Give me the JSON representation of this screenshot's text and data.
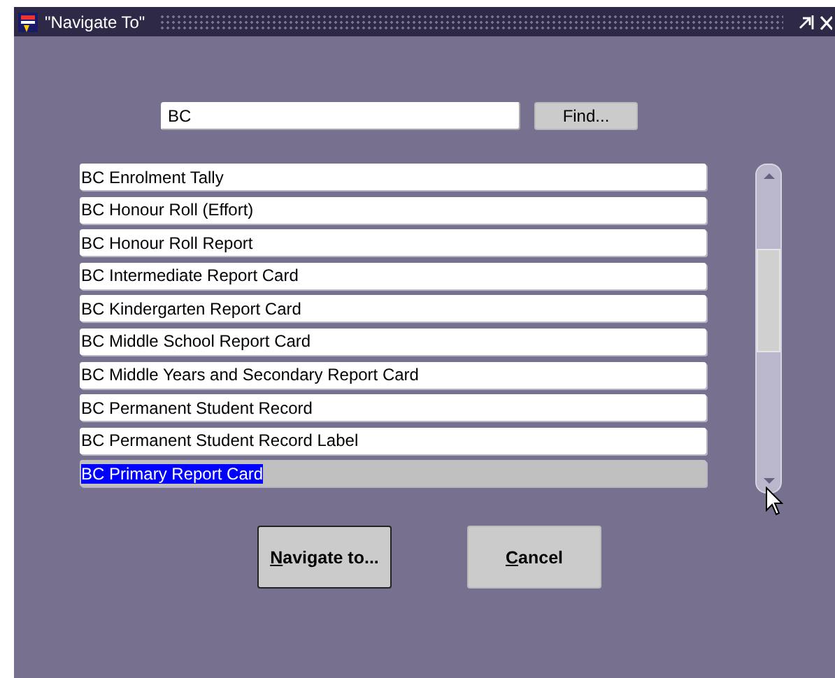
{
  "window": {
    "title": "\"Navigate To\""
  },
  "search": {
    "value": "BC"
  },
  "find_button": {
    "label": "Find..."
  },
  "items": [
    {
      "label": "BC Enrolment Tally",
      "selected": false
    },
    {
      "label": "BC Honour Roll (Effort)",
      "selected": false
    },
    {
      "label": "BC Honour Roll Report",
      "selected": false
    },
    {
      "label": "BC Intermediate Report Card",
      "selected": false
    },
    {
      "label": "BC Kindergarten Report Card",
      "selected": false
    },
    {
      "label": "BC Middle School Report Card",
      "selected": false
    },
    {
      "label": "BC Middle Years and Secondary Report Card",
      "selected": false
    },
    {
      "label": "BC Permanent Student Record",
      "selected": false
    },
    {
      "label": "BC Permanent Student Record Label",
      "selected": false
    },
    {
      "label": "BC Primary Report Card",
      "selected": true
    }
  ],
  "buttons": [
    {
      "label": "Navigate to...",
      "default": true
    },
    {
      "label": "Cancel",
      "default": false
    }
  ]
}
